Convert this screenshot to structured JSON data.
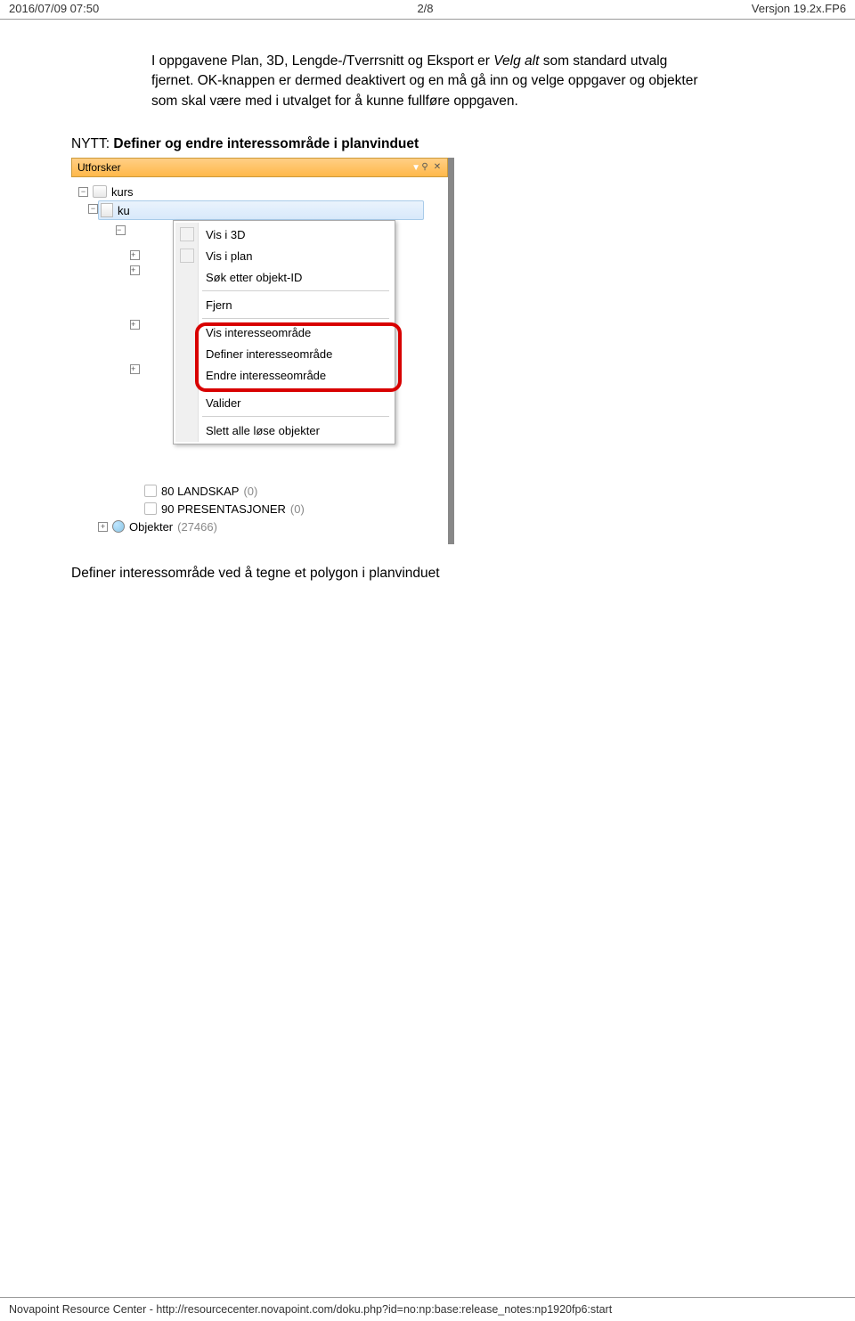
{
  "header": {
    "left": "2016/07/09 07:50",
    "center": "2/8",
    "right": "Versjon 19.2x.FP6"
  },
  "para1_a": "I oppgavene Plan, 3D, Lengde-/Tverrsnitt og Eksport er ",
  "para1_italic": "Velg alt",
  "para1_b": " som standard utvalg fjernet. OK-knappen er dermed deaktivert og en må gå inn og velge oppgaver og objekter som skal være med i utvalget for å kunne fullføre oppgaven.",
  "subhead_prefix": "NYTT: ",
  "subhead_bold": "Definer og endre interessområde i planvinduet",
  "shot": {
    "title": "Utforsker",
    "kurs": "kurs",
    "ku_sel": "ku",
    "menu": {
      "i1": "Vis i 3D",
      "i2": "Vis i plan",
      "i3": "Søk etter objekt-ID",
      "i4": "Fjern",
      "i5": "Vis interesseområde",
      "i6": "Definer interesseområde",
      "i7": "Endre interesseområde",
      "i8": "Valider",
      "i9": "Slett alle løse objekter"
    },
    "bottom": {
      "l1a": "80 LANDSKAP ",
      "l1b": "(0)",
      "l2a": "90 PRESENTASJONER ",
      "l2b": "(0)",
      "l3a": "Objekter ",
      "l3b": "(27466)"
    }
  },
  "def_text": "Definer interessområde ved å tegne et polygon i planvinduet",
  "footer": "Novapoint Resource Center - http://resourcecenter.novapoint.com/doku.php?id=no:np:base:release_notes:np1920fp6:start"
}
